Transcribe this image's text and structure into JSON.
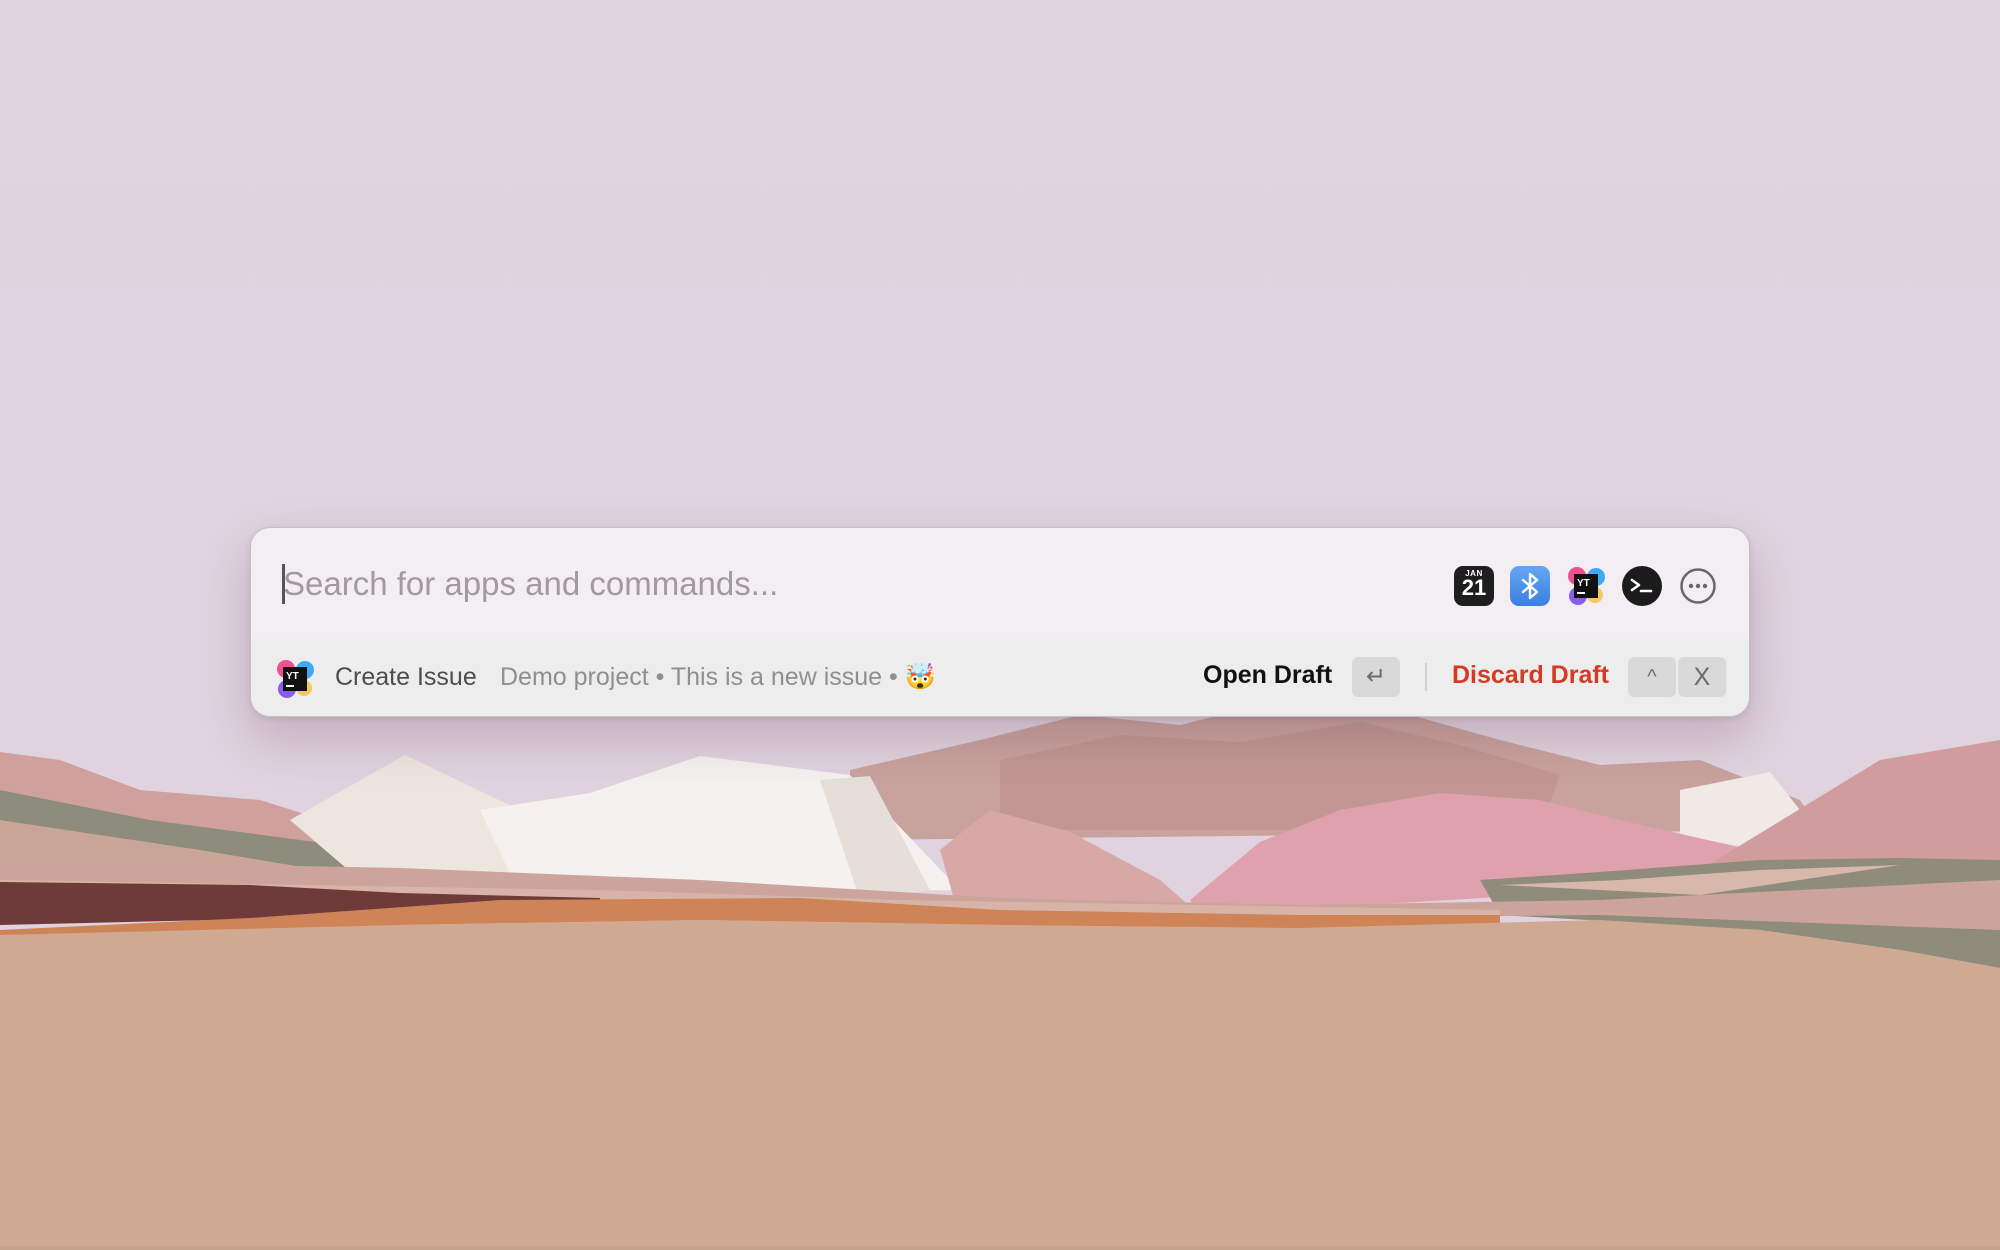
{
  "search": {
    "placeholder": "Search for apps and commands...",
    "value": ""
  },
  "quick_access": {
    "calendar": {
      "month": "JAN",
      "day": "21",
      "icon": "calendar-icon"
    },
    "items": [
      {
        "name": "calendar",
        "icon": "calendar-icon"
      },
      {
        "name": "bluetooth",
        "icon": "bluetooth-icon"
      },
      {
        "name": "youtrack",
        "icon": "youtrack-icon"
      },
      {
        "name": "terminal",
        "icon": "terminal-icon"
      },
      {
        "name": "more",
        "icon": "more-icon"
      }
    ],
    "youtrack_logo_text": "YT",
    "terminal_glyph": ">_"
  },
  "action_bar": {
    "title": "Create Issue",
    "subtitle": "Demo project • This is a new issue • 🤯",
    "app_icon": "youtrack-icon",
    "primary_label": "Open Draft",
    "primary_key": "↵",
    "secondary_label": "Discard Draft",
    "secondary_keys": [
      "^",
      "X"
    ]
  },
  "colors": {
    "danger": "#d53a22",
    "bluetooth": "#4a8ff0",
    "sky": "#e0d3dd",
    "sand": "#cfa990"
  }
}
